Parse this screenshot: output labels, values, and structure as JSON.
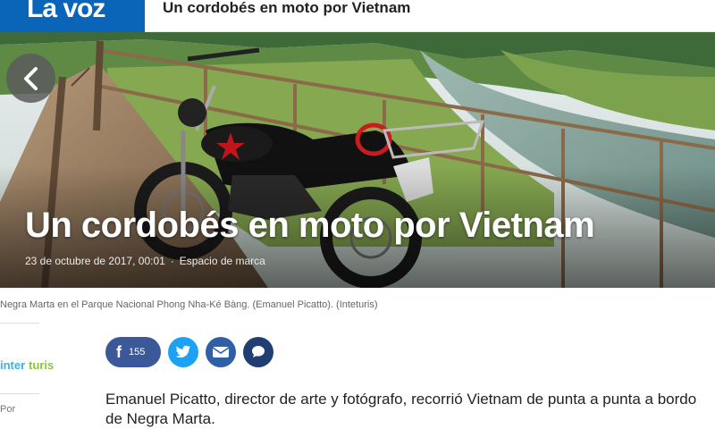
{
  "header": {
    "logo_text": "La voz",
    "article_title": "Un cordobés en moto por Vietnam"
  },
  "hero": {
    "title": "Un cordobés en moto por Vietnam",
    "date": "23 de octubre de 2017, 00:01",
    "section": "Espacio de marca",
    "prev_icon": "chevron-left-icon"
  },
  "caption": "Negra Marta en el Parque Nacional Phong Nha-Ké Bàng. (Emanuel Picatto). (Inteturis)",
  "sidebar": {
    "sponsor_logo_text": "Interturis",
    "byline_prefix": "Por"
  },
  "share": {
    "facebook_count": "155",
    "icons": [
      "facebook-icon",
      "twitter-icon",
      "mail-icon",
      "comment-icon"
    ]
  },
  "lead": "Emanuel Picatto, director de arte y fotógrafo, recorrió Vietnam de punta a punta a bordo de Negra Marta.",
  "colors": {
    "brand": "#0a64b7",
    "facebook": "#3b5998",
    "twitter": "#1da1f2",
    "mail": "#2f5fa6",
    "comment": "#1f3e73"
  }
}
